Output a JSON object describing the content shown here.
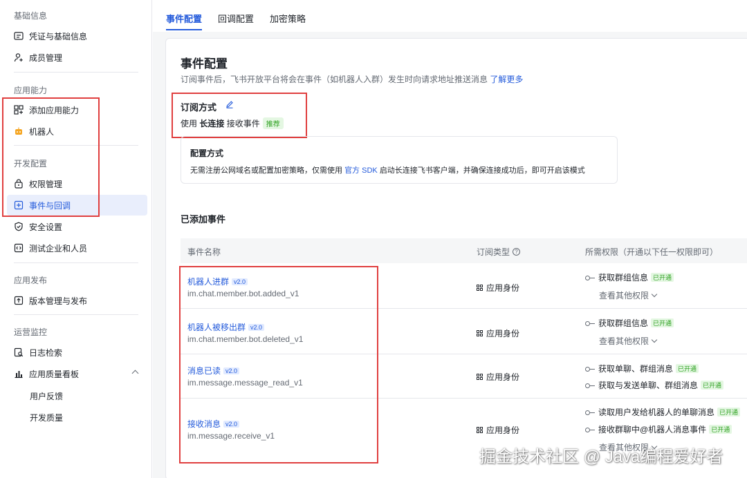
{
  "sidebar": {
    "groups": {
      "basic": "基础信息",
      "capability": "应用能力",
      "dev": "开发配置",
      "release": "应用发布",
      "ops": "运营监控"
    },
    "items": {
      "credentials": "凭证与基础信息",
      "members": "成员管理",
      "add_capability": "添加应用能力",
      "bot": "机器人",
      "permissions": "权限管理",
      "events": "事件与回调",
      "security": "安全设置",
      "test_users": "测试企业和人员",
      "version": "版本管理与发布",
      "logs": "日志检索",
      "quality": "应用质量看板",
      "feedback": "用户反馈",
      "dev_quality": "开发质量"
    }
  },
  "tabs": [
    "事件配置",
    "回调配置",
    "加密策略"
  ],
  "main": {
    "title": "事件配置",
    "desc": "订阅事件后，飞书开放平台将会在事件（如机器人入群）发生时向请求地址推送消息",
    "desc_link": "了解更多",
    "sub_title": "订阅方式",
    "sub_prefix": "使用",
    "sub_mode": "长连接",
    "sub_suffix": "接收事件",
    "sub_badge": "推荐",
    "cfg_title": "配置方式",
    "cfg_pre": "无需注册公网域名或配置加密策略，仅需使用",
    "cfg_link": "官方 SDK",
    "cfg_post": "启动长连接飞书客户端，并确保连接成功后，即可开启该模式",
    "added_title": "已添加事件"
  },
  "table": {
    "col_name": "事件名称",
    "col_type": "订阅类型",
    "col_perm": "所需权限（开通以下任一权限即可）",
    "more_label": "查看其他权限",
    "open_badge": "已开通",
    "rows": [
      {
        "name": "机器人进群",
        "version": "v2.0",
        "id": "im.chat.member.bot.added_v1",
        "type": "应用身份",
        "perms": [
          "获取群组信息"
        ],
        "more": true
      },
      {
        "name": "机器人被移出群",
        "version": "v2.0",
        "id": "im.chat.member.bot.deleted_v1",
        "type": "应用身份",
        "perms": [
          "获取群组信息"
        ],
        "more": true
      },
      {
        "name": "消息已读",
        "version": "v2.0",
        "id": "im.message.message_read_v1",
        "type": "应用身份",
        "perms": [
          "获取单聊、群组消息",
          "获取与发送单聊、群组消息"
        ],
        "more": false
      },
      {
        "name": "接收消息",
        "version": "v2.0",
        "id": "im.message.receive_v1",
        "type": "应用身份",
        "perms": [
          "读取用户发给机器人的单聊消息",
          "接收群聊中@机器人消息事件"
        ],
        "more": true
      }
    ]
  },
  "watermark": "掘金技术社区 @ Java编程爱好者",
  "colors": {
    "accent": "#245bdb",
    "highlight": "#e03e3e",
    "success": "#2ea121"
  }
}
